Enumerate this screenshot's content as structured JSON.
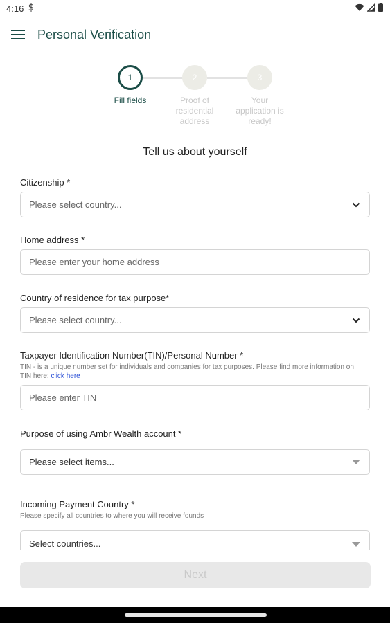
{
  "status_bar": {
    "time": "4:16",
    "left_icon": "sync-s-icon",
    "right_icons": [
      "wifi-icon",
      "signal-icon",
      "battery-icon"
    ]
  },
  "app_bar": {
    "title": "Personal Verification",
    "menu_icon": "hamburger-menu-icon"
  },
  "stepper": {
    "steps": [
      {
        "number": "1",
        "label": "Fill fields",
        "state": "active"
      },
      {
        "number": "2",
        "label": "Proof of residential address",
        "state": "inactive"
      },
      {
        "number": "3",
        "label": "Your application is ready!",
        "state": "inactive"
      }
    ]
  },
  "form": {
    "heading": "Tell us about yourself",
    "citizenship": {
      "label": "Citizenship *",
      "placeholder": "Please select country..."
    },
    "home_address": {
      "label": "Home address *",
      "placeholder": "Please enter your home address"
    },
    "tax_country": {
      "label": "Country of residence for tax purpose*",
      "placeholder": "Please select country..."
    },
    "tin": {
      "label": "Taxpayer Identification Number(TIN)/Personal Number *",
      "help": "TIN - is a unique number set for individuals and companies for tax purposes. Please find more information on TIN here: ",
      "help_link": "click here",
      "placeholder": "Please enter TIN"
    },
    "purpose": {
      "label": "Purpose of using Ambr Wealth account *",
      "placeholder": "Please select items..."
    },
    "incoming_country": {
      "label": "Incoming Payment Country *",
      "help": "Please specify all countries to where you will receive founds",
      "placeholder": "Select countries..."
    }
  },
  "actions": {
    "next_label": "Next"
  },
  "colors": {
    "accent": "#1b4d47",
    "disabled_bg": "#e8e8e8",
    "disabled_text": "#c9c9c9",
    "link": "#2a4fd6"
  }
}
